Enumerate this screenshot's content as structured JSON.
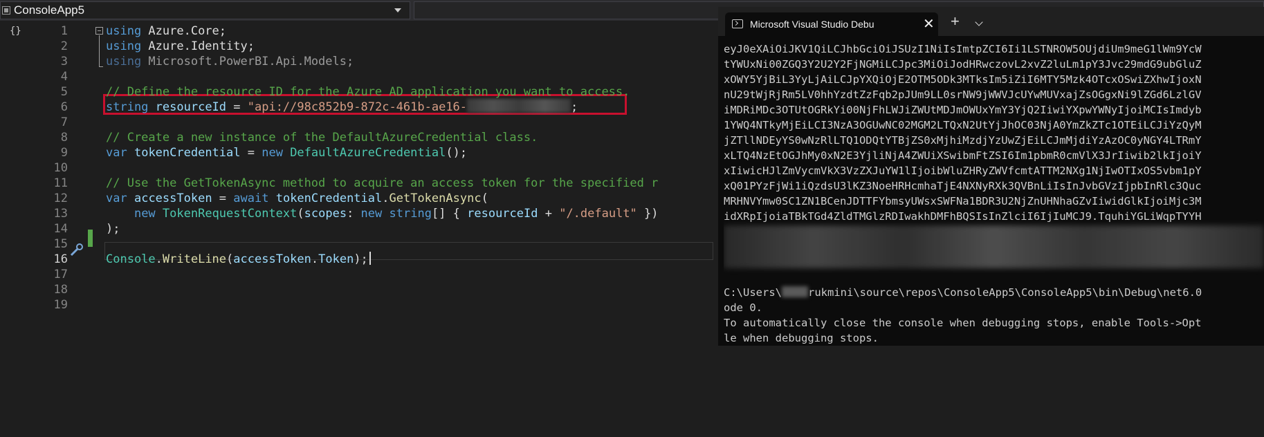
{
  "toolbar": {
    "project_dropdown_label": "ConsoleApp5"
  },
  "editor": {
    "margin_icon": "{}",
    "line_numbers": [
      "1",
      "2",
      "3",
      "4",
      "5",
      "6",
      "7",
      "8",
      "9",
      "10",
      "11",
      "12",
      "13",
      "14",
      "15",
      "16",
      "17",
      "18",
      "19"
    ],
    "active_line": "16",
    "lines": {
      "l1": {
        "kw": "using",
        "rest": " Azure.Core;"
      },
      "l2": {
        "kw": "using",
        "rest": " Azure.Identity;"
      },
      "l3": {
        "kw": "using",
        "rest": " Microsoft.PowerBI.Api.Models;"
      },
      "l5": {
        "comment": "// Define the resource ID for the Azure AD application you want to access."
      },
      "l6": {
        "kw": "string",
        "var": "resourceId",
        "eq": " = ",
        "str": "\"api://98c852b9-872c-461b-ae16-",
        "end": ";"
      },
      "l8": {
        "comment": "// Create a new instance of the DefaultAzureCredential class."
      },
      "l9": {
        "kw": "var",
        "var": "tokenCredential",
        "eq": " = ",
        "kw2": "new",
        "type": "DefaultAzureCredential",
        "end": "();"
      },
      "l11": {
        "comment": "// Use the GetTokenAsync method to acquire an access token for the specified r"
      },
      "l12": {
        "kw": "var",
        "var": "accessToken",
        "eq": " = ",
        "kw2": "await",
        "obj": "tokenCredential",
        "dot": ".",
        "meth": "GetTokenAsync",
        "end": "("
      },
      "l13": {
        "kw": "new",
        "type": "TokenRequestContext",
        "p1": "(",
        "param": "scopes",
        "p2": ": ",
        "kw2": "new",
        "kw3": "string",
        "p3": "[] { ",
        "var": "resourceId",
        "p4": " + ",
        "str": "\"/.default\"",
        "end": " })"
      },
      "l14": {
        "text": ");"
      },
      "l16": {
        "type": "Console",
        "dot": ".",
        "meth": "WriteLine",
        "p1": "(",
        "var": "accessToken",
        "dot2": ".",
        "prop": "Token",
        "end": ");"
      }
    }
  },
  "console": {
    "tab_title": "Microsoft Visual Studio Debu",
    "tab_close": "✕",
    "new_tab": "+",
    "output_lines": [
      "eyJ0eXAiOiJKV1QiLCJhbGciOiJSUzI1NiIsImtpZCI6Ii1LSTNROW5OUjdiUm9meG1lWm9YcW",
      "tYWUxNi00ZGQ3Y2U2Y2FjNGMiLCJpc3MiOiJodHRwczovL2xvZ2luLm1pY3Jvc29mdG9ubGluZ",
      "xOWY5YjBiL3YyLjAiLCJpYXQiOjE2OTM5ODk3MTksIm5iZiI6MTY5Mzk4OTcxOSwiZXhwIjoxN",
      "nU29tWjRjRm5LV0hhYzdtZzFqb2pJUm9LL0srNW9jWWVJcUYwMUVxajZsOGgxNi9lZGd6LzlGV",
      "iMDRiMDc3OTUtOGRkYi00NjFhLWJiZWUtMDJmOWUxYmY3YjQ2IiwiYXpwYWNyIjoiMCIsImdyb",
      "1YWQ4NTkyMjEiLCI3NzA3OGUwNC02MGM2LTQxN2UtYjJhOC03NjA0YmZkZTc1OTEiLCJiYzQyM",
      "jZTllNDEyYS0wNzRlLTQ1ODQtYTBjZS0xMjhiMzdjYzUwZjEiLCJmMjdiYzAzOC0yNGY4LTRmY",
      "xLTQ4NzEtOGJhMy0xN2E3YjliNjA4ZWUiXSwibmFtZSI6Im1pbmR0cmVlX3JrIiwib2lkIjoiY",
      "xIiwicHJlZmVycmVkX3VzZXJuYW1lIjoibWluZHRyZWVfcmtATTM2NXg1NjIwOTIxOS5vbm1pY",
      "xQ01PYzFjWi1iQzdsU3lKZ3NoeHRHcmhaTjE4NXNyRXk3QVBnLiIsInJvbGVzIjpbInRlc3Quc",
      "MRHNVYmw0SC1ZN1BCenJDTTFYbmsyUWsxSWFNa1BDR3U2NjZnUHNhaGZvIiwidGlkIjoiMjc3M",
      "idXRpIjoiaTBkTGd4ZldTMGlzRDIwakhDMFhBQSIsInZlciI6IjIuMCJ9.TquhiYGLiWqpTYYH"
    ],
    "path_prefix": "C:\\Users\\",
    "path_suffix": "rukmini\\source\\repos\\ConsoleApp5\\ConsoleApp5\\bin\\Debug\\net6.0",
    "line_code": "ode 0.",
    "line_hint1": "To automatically close the console when debugging stops, enable Tools->Opt",
    "line_hint2": "le when debugging stops."
  }
}
